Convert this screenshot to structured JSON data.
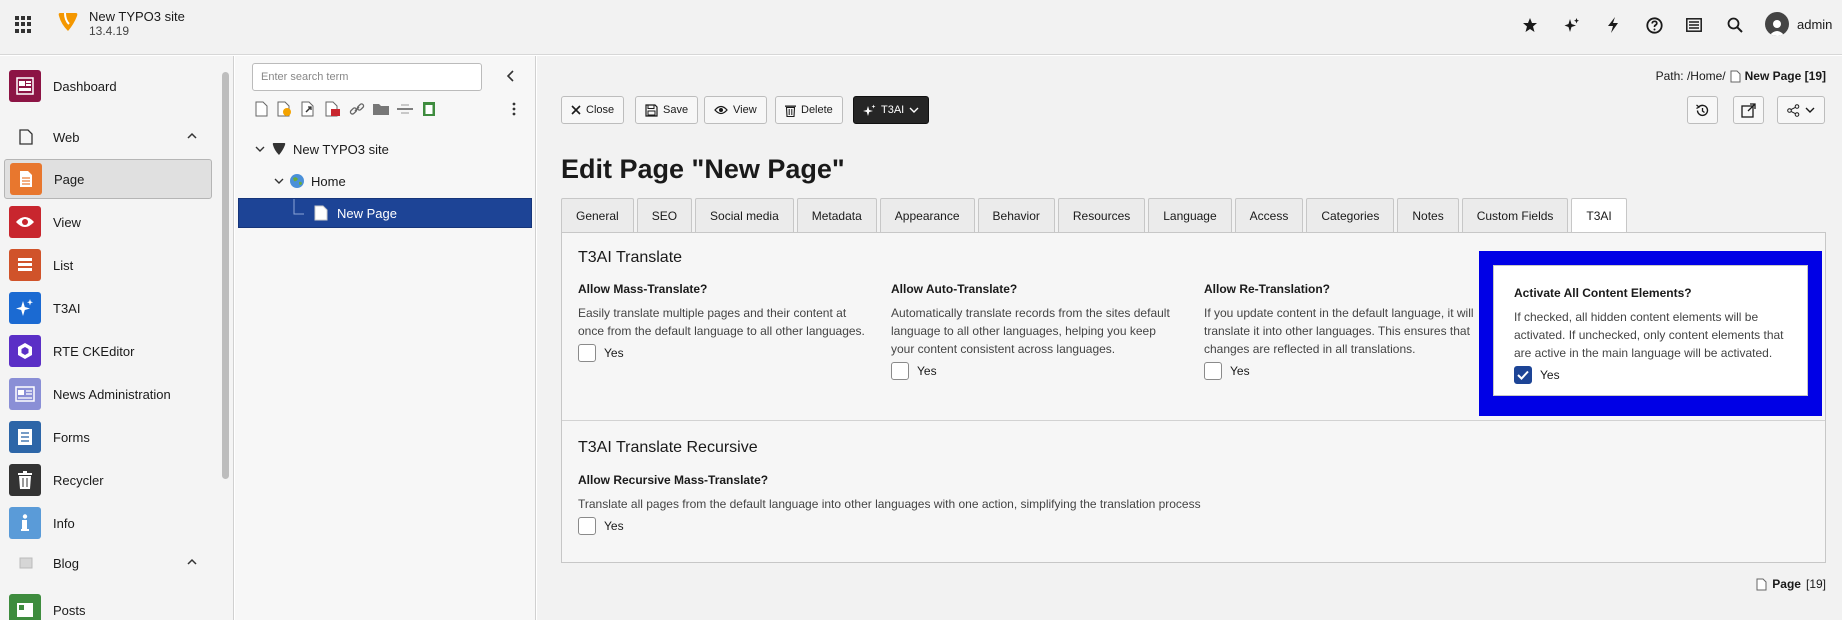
{
  "topbar": {
    "site_name": "New TYPO3 site",
    "site_version": "13.4.19",
    "user_name": "admin",
    "tools": [
      "star-icon",
      "sparkles-icon",
      "bolt-icon",
      "help-icon",
      "list-icon",
      "search-icon"
    ]
  },
  "modules": {
    "dashboard": "Dashboard",
    "web_group": "Web",
    "page": "Page",
    "view": "View",
    "list": "List",
    "t3ai": "T3AI",
    "rte": "RTE CKEditor",
    "news": "News Administration",
    "forms": "Forms",
    "recycler": "Recycler",
    "info": "Info",
    "blog_group": "Blog",
    "posts": "Posts"
  },
  "tree": {
    "search_placeholder": "Enter search term",
    "nodes": {
      "root": "New TYPO3 site",
      "home": "Home",
      "new_page": "New Page"
    }
  },
  "content": {
    "path_label": "Path: /Home/",
    "path_page": "New Page [19]",
    "buttons": {
      "close": "Close",
      "save": "Save",
      "view": "View",
      "delete": "Delete",
      "t3ai": "T3AI"
    },
    "title": "Edit Page \"New Page\"",
    "tabs": [
      "General",
      "SEO",
      "Social media",
      "Metadata",
      "Appearance",
      "Behavior",
      "Resources",
      "Language",
      "Access",
      "Categories",
      "Notes",
      "Custom Fields",
      "T3AI"
    ],
    "section1": {
      "title": "T3AI Translate",
      "fields": [
        {
          "label": "Allow Mass-Translate?",
          "desc": "Easily translate multiple pages and their content at once from the default language to all other languages.",
          "option": "Yes",
          "checked": false
        },
        {
          "label": "Allow Auto-Translate?",
          "desc": "Automatically translate records from the sites default language to all other languages, helping you keep your content consistent across languages.",
          "option": "Yes",
          "checked": false
        },
        {
          "label": "Allow Re-Translation?",
          "desc": "If you update content in the default language, it will translate it into other languages. This ensures that changes are reflected in all translations.",
          "option": "Yes",
          "checked": false
        },
        {
          "label": "Activate All Content Elements?",
          "desc": "If checked, all hidden content elements will be activated. If unchecked, only content elements that are active in the main language will be activated.",
          "option": "Yes",
          "checked": true
        }
      ]
    },
    "section2": {
      "title": "T3AI Translate Recursive",
      "field": {
        "label": "Allow Recursive Mass-Translate?",
        "desc": "Translate all pages from the default language into other languages with one action, simplifying the translation process",
        "option": "Yes",
        "checked": false
      }
    },
    "footer": {
      "page_label": "Page",
      "page_id": "[19]"
    }
  },
  "colors": {
    "highlight": "#0000e6",
    "selected_node": "#1d4496",
    "typo3_orange": "#f49700"
  }
}
